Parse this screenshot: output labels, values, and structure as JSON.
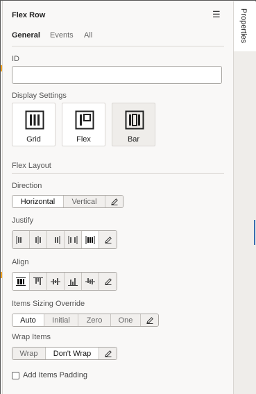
{
  "panel": {
    "title": "Flex Row",
    "tabs": [
      {
        "label": "General",
        "active": true
      },
      {
        "label": "Events",
        "active": false
      },
      {
        "label": "All",
        "active": false
      }
    ]
  },
  "rail": {
    "tab_label": "Properties"
  },
  "id_field": {
    "label": "ID",
    "value": "",
    "placeholder": ""
  },
  "display_settings": {
    "label": "Display Settings",
    "options": [
      {
        "label": "Grid",
        "icon": "grid-layout-icon",
        "selected": true
      },
      {
        "label": "Flex",
        "icon": "flex-layout-icon",
        "selected": false
      },
      {
        "label": "Bar",
        "icon": "bar-layout-icon",
        "selected": false
      }
    ]
  },
  "flex_layout": {
    "label": "Flex Layout"
  },
  "direction": {
    "label": "Direction",
    "options": [
      {
        "label": "Horizontal",
        "selected": true
      },
      {
        "label": "Vertical",
        "selected": false
      }
    ],
    "edit_icon": "pencil-icon"
  },
  "justify": {
    "label": "Justify",
    "options": [
      {
        "icon": "justify-start-icon",
        "selected": false
      },
      {
        "icon": "justify-center-icon",
        "selected": false
      },
      {
        "icon": "justify-end-icon",
        "selected": false
      },
      {
        "icon": "justify-space-between-icon",
        "selected": false
      },
      {
        "icon": "justify-space-around-icon",
        "selected": true
      }
    ],
    "edit_icon": "pencil-icon"
  },
  "align": {
    "label": "Align",
    "options": [
      {
        "icon": "align-stretch-icon",
        "selected": true
      },
      {
        "icon": "align-start-icon",
        "selected": false
      },
      {
        "icon": "align-center-icon",
        "selected": false
      },
      {
        "icon": "align-end-icon",
        "selected": false
      },
      {
        "icon": "align-baseline-icon",
        "selected": false
      }
    ],
    "edit_icon": "pencil-icon"
  },
  "sizing": {
    "label": "Items Sizing Override",
    "options": [
      {
        "label": "Auto",
        "selected": true
      },
      {
        "label": "Initial",
        "selected": false
      },
      {
        "label": "Zero",
        "selected": false
      },
      {
        "label": "One",
        "selected": false
      }
    ],
    "edit_icon": "pencil-icon"
  },
  "wrap": {
    "label": "Wrap Items",
    "options": [
      {
        "label": "Wrap",
        "selected": false
      },
      {
        "label": "Don't Wrap",
        "selected": true
      }
    ],
    "edit_icon": "pencil-icon"
  },
  "padding": {
    "label": "Add Items Padding",
    "checked": false
  },
  "colors": {
    "accent_marker": "#f2a21d",
    "rail_line": "#3a6fb0",
    "panel_bg": "#f9f8f7"
  }
}
